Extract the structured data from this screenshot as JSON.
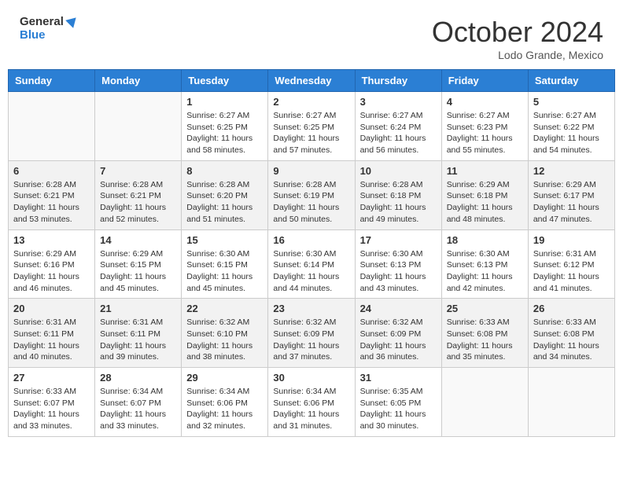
{
  "header": {
    "logo_line1": "General",
    "logo_line2": "Blue",
    "month": "October 2024",
    "location": "Lodo Grande, Mexico"
  },
  "weekdays": [
    "Sunday",
    "Monday",
    "Tuesday",
    "Wednesday",
    "Thursday",
    "Friday",
    "Saturday"
  ],
  "weeks": [
    [
      {
        "day": "",
        "sunrise": "",
        "sunset": "",
        "daylight": ""
      },
      {
        "day": "",
        "sunrise": "",
        "sunset": "",
        "daylight": ""
      },
      {
        "day": "1",
        "sunrise": "Sunrise: 6:27 AM",
        "sunset": "Sunset: 6:25 PM",
        "daylight": "Daylight: 11 hours and 58 minutes."
      },
      {
        "day": "2",
        "sunrise": "Sunrise: 6:27 AM",
        "sunset": "Sunset: 6:25 PM",
        "daylight": "Daylight: 11 hours and 57 minutes."
      },
      {
        "day": "3",
        "sunrise": "Sunrise: 6:27 AM",
        "sunset": "Sunset: 6:24 PM",
        "daylight": "Daylight: 11 hours and 56 minutes."
      },
      {
        "day": "4",
        "sunrise": "Sunrise: 6:27 AM",
        "sunset": "Sunset: 6:23 PM",
        "daylight": "Daylight: 11 hours and 55 minutes."
      },
      {
        "day": "5",
        "sunrise": "Sunrise: 6:27 AM",
        "sunset": "Sunset: 6:22 PM",
        "daylight": "Daylight: 11 hours and 54 minutes."
      }
    ],
    [
      {
        "day": "6",
        "sunrise": "Sunrise: 6:28 AM",
        "sunset": "Sunset: 6:21 PM",
        "daylight": "Daylight: 11 hours and 53 minutes."
      },
      {
        "day": "7",
        "sunrise": "Sunrise: 6:28 AM",
        "sunset": "Sunset: 6:21 PM",
        "daylight": "Daylight: 11 hours and 52 minutes."
      },
      {
        "day": "8",
        "sunrise": "Sunrise: 6:28 AM",
        "sunset": "Sunset: 6:20 PM",
        "daylight": "Daylight: 11 hours and 51 minutes."
      },
      {
        "day": "9",
        "sunrise": "Sunrise: 6:28 AM",
        "sunset": "Sunset: 6:19 PM",
        "daylight": "Daylight: 11 hours and 50 minutes."
      },
      {
        "day": "10",
        "sunrise": "Sunrise: 6:28 AM",
        "sunset": "Sunset: 6:18 PM",
        "daylight": "Daylight: 11 hours and 49 minutes."
      },
      {
        "day": "11",
        "sunrise": "Sunrise: 6:29 AM",
        "sunset": "Sunset: 6:18 PM",
        "daylight": "Daylight: 11 hours and 48 minutes."
      },
      {
        "day": "12",
        "sunrise": "Sunrise: 6:29 AM",
        "sunset": "Sunset: 6:17 PM",
        "daylight": "Daylight: 11 hours and 47 minutes."
      }
    ],
    [
      {
        "day": "13",
        "sunrise": "Sunrise: 6:29 AM",
        "sunset": "Sunset: 6:16 PM",
        "daylight": "Daylight: 11 hours and 46 minutes."
      },
      {
        "day": "14",
        "sunrise": "Sunrise: 6:29 AM",
        "sunset": "Sunset: 6:15 PM",
        "daylight": "Daylight: 11 hours and 45 minutes."
      },
      {
        "day": "15",
        "sunrise": "Sunrise: 6:30 AM",
        "sunset": "Sunset: 6:15 PM",
        "daylight": "Daylight: 11 hours and 45 minutes."
      },
      {
        "day": "16",
        "sunrise": "Sunrise: 6:30 AM",
        "sunset": "Sunset: 6:14 PM",
        "daylight": "Daylight: 11 hours and 44 minutes."
      },
      {
        "day": "17",
        "sunrise": "Sunrise: 6:30 AM",
        "sunset": "Sunset: 6:13 PM",
        "daylight": "Daylight: 11 hours and 43 minutes."
      },
      {
        "day": "18",
        "sunrise": "Sunrise: 6:30 AM",
        "sunset": "Sunset: 6:13 PM",
        "daylight": "Daylight: 11 hours and 42 minutes."
      },
      {
        "day": "19",
        "sunrise": "Sunrise: 6:31 AM",
        "sunset": "Sunset: 6:12 PM",
        "daylight": "Daylight: 11 hours and 41 minutes."
      }
    ],
    [
      {
        "day": "20",
        "sunrise": "Sunrise: 6:31 AM",
        "sunset": "Sunset: 6:11 PM",
        "daylight": "Daylight: 11 hours and 40 minutes."
      },
      {
        "day": "21",
        "sunrise": "Sunrise: 6:31 AM",
        "sunset": "Sunset: 6:11 PM",
        "daylight": "Daylight: 11 hours and 39 minutes."
      },
      {
        "day": "22",
        "sunrise": "Sunrise: 6:32 AM",
        "sunset": "Sunset: 6:10 PM",
        "daylight": "Daylight: 11 hours and 38 minutes."
      },
      {
        "day": "23",
        "sunrise": "Sunrise: 6:32 AM",
        "sunset": "Sunset: 6:09 PM",
        "daylight": "Daylight: 11 hours and 37 minutes."
      },
      {
        "day": "24",
        "sunrise": "Sunrise: 6:32 AM",
        "sunset": "Sunset: 6:09 PM",
        "daylight": "Daylight: 11 hours and 36 minutes."
      },
      {
        "day": "25",
        "sunrise": "Sunrise: 6:33 AM",
        "sunset": "Sunset: 6:08 PM",
        "daylight": "Daylight: 11 hours and 35 minutes."
      },
      {
        "day": "26",
        "sunrise": "Sunrise: 6:33 AM",
        "sunset": "Sunset: 6:08 PM",
        "daylight": "Daylight: 11 hours and 34 minutes."
      }
    ],
    [
      {
        "day": "27",
        "sunrise": "Sunrise: 6:33 AM",
        "sunset": "Sunset: 6:07 PM",
        "daylight": "Daylight: 11 hours and 33 minutes."
      },
      {
        "day": "28",
        "sunrise": "Sunrise: 6:34 AM",
        "sunset": "Sunset: 6:07 PM",
        "daylight": "Daylight: 11 hours and 33 minutes."
      },
      {
        "day": "29",
        "sunrise": "Sunrise: 6:34 AM",
        "sunset": "Sunset: 6:06 PM",
        "daylight": "Daylight: 11 hours and 32 minutes."
      },
      {
        "day": "30",
        "sunrise": "Sunrise: 6:34 AM",
        "sunset": "Sunset: 6:06 PM",
        "daylight": "Daylight: 11 hours and 31 minutes."
      },
      {
        "day": "31",
        "sunrise": "Sunrise: 6:35 AM",
        "sunset": "Sunset: 6:05 PM",
        "daylight": "Daylight: 11 hours and 30 minutes."
      },
      {
        "day": "",
        "sunrise": "",
        "sunset": "",
        "daylight": ""
      },
      {
        "day": "",
        "sunrise": "",
        "sunset": "",
        "daylight": ""
      }
    ]
  ]
}
